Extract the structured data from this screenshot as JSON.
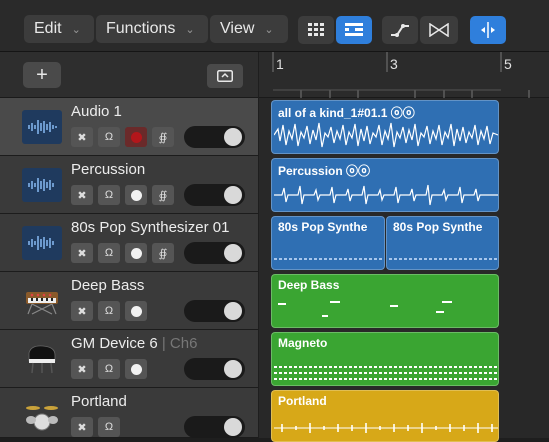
{
  "toolbar": {
    "menus": [
      {
        "label": "Edit"
      },
      {
        "label": "Functions"
      },
      {
        "label": "View"
      }
    ],
    "chevron": "⌄"
  },
  "ruler": {
    "bars": [
      "1",
      "3",
      "5"
    ]
  },
  "tracks": [
    {
      "name": "Audio 1",
      "sub": "",
      "icon": "audio-waveform-icon",
      "selected": true
    },
    {
      "name": "Percussion",
      "sub": "",
      "icon": "audio-waveform-icon",
      "selected": false
    },
    {
      "name": "80s Pop Synthesizer 01",
      "sub": "",
      "icon": "audio-waveform-icon",
      "selected": false
    },
    {
      "name": "Deep Bass",
      "sub": "",
      "icon": "synthesizer-icon",
      "selected": false
    },
    {
      "name": "GM Device 6",
      "sub": " | Ch6",
      "icon": "piano-icon",
      "selected": false
    },
    {
      "name": "Portland",
      "sub": "",
      "icon": "drum-kit-icon",
      "selected": false
    }
  ],
  "regions": [
    {
      "name": "all of a kind_1#01.1 ⓞⓞ",
      "color": "blue"
    },
    {
      "name": "Percussion ⓞⓞ",
      "color": "blue"
    },
    {
      "name": "80s Pop Synthe",
      "color": "blue"
    },
    {
      "name": "80s Pop Synthe",
      "color": "blue"
    },
    {
      "name": "Deep Bass",
      "color": "green"
    },
    {
      "name": "Magneto",
      "color": "green"
    },
    {
      "name": "Portland",
      "color": "yellow"
    }
  ],
  "colors": {
    "blue_region": "#2f6fb3",
    "green_region": "#3aa532",
    "yellow_region": "#d7a818",
    "accent": "#2f7fdc",
    "record": "#b3161b"
  }
}
